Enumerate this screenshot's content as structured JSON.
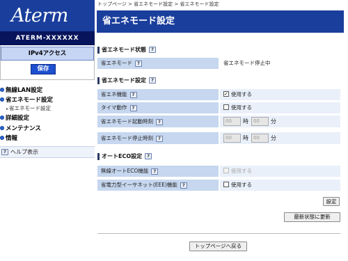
{
  "sidebar": {
    "logo": "Aterm",
    "device_name": "ATERM-XXXXXX",
    "mode": "IPv4アクセス",
    "save_label": "保存",
    "nav": [
      {
        "label": "無線LAN設定"
      },
      {
        "label": "省エネモード設定"
      },
      {
        "label": "省エネモード設定",
        "sub": true
      },
      {
        "label": "詳細設定"
      },
      {
        "label": "メンテナンス"
      },
      {
        "label": "情報"
      }
    ],
    "help_label": "ヘルプ表示",
    "help_icon": "?"
  },
  "breadcrumb": "トップページ > 省エネモード設定 > 省エネモード設定",
  "page_title": "省エネモード設定",
  "sections": {
    "status": {
      "title": "省エネモード状態",
      "rows": [
        {
          "label": "省エネモード",
          "value": "省エネモード停止中"
        }
      ]
    },
    "settings": {
      "title": "省エネモード設定",
      "rows": [
        {
          "label": "省エネ機能",
          "checkbox_label": "使用する",
          "checked": true
        },
        {
          "label": "タイマ動作",
          "checkbox_label": "使用する",
          "checked": false
        },
        {
          "label": "省エネモード起動時刻",
          "hour": "00",
          "hour_unit": "時",
          "minute": "00",
          "minute_unit": "分"
        },
        {
          "label": "省エネモード停止時刻",
          "hour": "00",
          "hour_unit": "時",
          "minute": "00",
          "minute_unit": "分"
        }
      ]
    },
    "eco": {
      "title": "オートECO設定",
      "rows": [
        {
          "label": "無線オートECO機能",
          "checkbox_label": "使用する",
          "checked": false,
          "disabled": true
        },
        {
          "label": "省電力型イーサネット(EEE)機能",
          "checkbox_label": "使用する",
          "checked": false
        }
      ]
    }
  },
  "buttons": {
    "setting": "設定",
    "refresh": "最新状態に更新",
    "top": "トップページへ戻る"
  },
  "icons": {
    "help": "help-question-icon",
    "check": "✓"
  },
  "colors": {
    "brand": "#1a3e9c",
    "brand_dark": "#08145c",
    "label_bg": "#c6d7ef",
    "value_bg": "#e9f0fa"
  }
}
